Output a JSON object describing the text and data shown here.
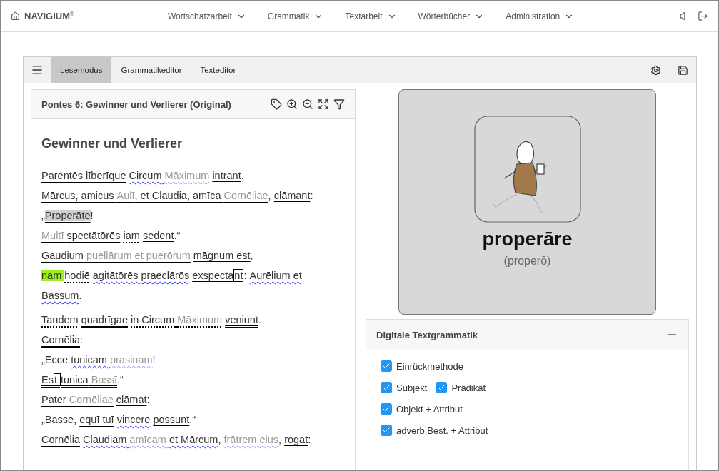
{
  "navbar": {
    "brand": "NAVIGIUM",
    "brand_mark": "®",
    "menus": [
      "Wortschatzarbeit",
      "Grammatik",
      "Textarbeit",
      "Wörterbücher",
      "Administration"
    ]
  },
  "toolbar": {
    "tabs": [
      {
        "label": "Lesemodus",
        "selected": true
      },
      {
        "label": "Grammatikeditor",
        "selected": false
      },
      {
        "label": "Texteditor",
        "selected": false
      }
    ]
  },
  "text_panel": {
    "title": "Pontes 6: Gewinner und Verlierer (Original)",
    "heading": "Gewinner und Verlierer",
    "paragraphs": [
      [
        [
          {
            "text": "Parentēs līberīque",
            "kind": "solid"
          },
          {
            "text": "Circum",
            "kind": "wavy"
          },
          {
            "text": "Māximum",
            "kind": "wavy",
            "muted": true
          },
          {
            "text": "intrant",
            "kind": "double",
            "joined": true
          },
          {
            "text": ".",
            "kind": "none"
          }
        ],
        [
          {
            "text": "Mārcus, amicus",
            "kind": "solid"
          },
          {
            "text": "Aulī",
            "kind": "solid",
            "muted": true,
            "joined": true
          },
          {
            "text": ", et Claudia, amīca",
            "kind": "solid"
          },
          {
            "text": "Cornēliae",
            "kind": "solid",
            "muted": true,
            "joined": true
          },
          {
            "text": ",",
            "kind": "none"
          },
          {
            "text": "clāmant",
            "kind": "double",
            "joined": true
          },
          {
            "text": ":",
            "kind": "none"
          }
        ],
        [
          {
            "text": "„",
            "kind": "none",
            "joined": true
          },
          {
            "text": "Properāte",
            "kind": "solid",
            "selected": true,
            "joined": true
          },
          {
            "text": "!",
            "kind": "none"
          }
        ],
        [
          {
            "text": "Multī",
            "kind": "solid",
            "muted": true
          },
          {
            "text": "spectātōrēs",
            "kind": "solid"
          },
          {
            "text": "iam",
            "kind": "dotted"
          },
          {
            "text": "sedent",
            "kind": "double",
            "joined": true
          },
          {
            "text": ".“",
            "kind": "none"
          }
        ],
        [
          {
            "text": "Gaudium",
            "kind": "solid"
          },
          {
            "text": "puellārum et puerōrum",
            "kind": "solid",
            "muted": true
          },
          {
            "text": "māgnum est",
            "kind": "double",
            "joined": true
          },
          {
            "text": ",",
            "kind": "none"
          }
        ],
        [
          {
            "text": "nam",
            "kind": "none",
            "marked": true
          },
          {
            "text": "hodiē",
            "kind": "dotted"
          },
          {
            "text": "agitātōrēs",
            "kind": "wavy"
          },
          {
            "text": "praeclārōs",
            "kind": "wavy"
          },
          {
            "text": "exspecta",
            "kind": "double",
            "joined": true
          },
          {
            "text": "nt",
            "kind": "double",
            "boxed": true,
            "joined": true
          },
          {
            "text": ":",
            "kind": "none"
          },
          {
            "text": "Aurēlium et",
            "kind": "wavy"
          }
        ],
        [
          {
            "text": "Bassum",
            "kind": "wavy",
            "joined": true
          },
          {
            "text": ".",
            "kind": "none"
          }
        ]
      ],
      [
        [
          {
            "text": "Tandem",
            "kind": "dotted"
          },
          {
            "text": "quadrīgae",
            "kind": "solid"
          },
          {
            "text": "in Circum",
            "kind": "dotted"
          },
          {
            "text": "Māximum",
            "kind": "dotted",
            "muted": true
          },
          {
            "text": "veniunt",
            "kind": "double",
            "joined": true
          },
          {
            "text": ".",
            "kind": "none"
          }
        ],
        [
          {
            "text": "Cornēlia",
            "kind": "solid",
            "joined": true
          },
          {
            "text": ":",
            "kind": "none"
          }
        ],
        [
          {
            "text": "„Ecce",
            "kind": "none"
          },
          {
            "text": "tunicam",
            "kind": "wavy"
          },
          {
            "text": "prasinam",
            "kind": "wavy",
            "muted": true,
            "joined": true
          },
          {
            "text": "!",
            "kind": "none"
          }
        ],
        [
          {
            "text": "Es",
            "kind": "double",
            "joined": true
          },
          {
            "text": "t",
            "kind": "double",
            "boxed": true
          },
          {
            "text": "tunica",
            "kind": "double"
          },
          {
            "text": "Bassī",
            "kind": "double",
            "muted": true,
            "joined": true
          },
          {
            "text": ".“",
            "kind": "none"
          }
        ],
        [
          {
            "text": "Pater",
            "kind": "solid"
          },
          {
            "text": "Cornēliae",
            "kind": "solid",
            "muted": true
          },
          {
            "text": "clāmat",
            "kind": "double",
            "joined": true
          },
          {
            "text": ":",
            "kind": "none"
          }
        ],
        [
          {
            "text": "„Basse,",
            "kind": "none"
          },
          {
            "text": "equī tuī",
            "kind": "solid"
          },
          {
            "text": "vincere",
            "kind": "wavy"
          },
          {
            "text": "possunt",
            "kind": "double",
            "joined": true
          },
          {
            "text": ".“",
            "kind": "none"
          }
        ],
        [
          {
            "text": "Cornēlia",
            "kind": "solid"
          },
          {
            "text": "Claudiam",
            "kind": "wavy"
          },
          {
            "text": "amīcam",
            "kind": "wavy",
            "muted": true
          },
          {
            "text": "et Mārcum",
            "kind": "wavy",
            "joined": true
          },
          {
            "text": ",",
            "kind": "none"
          },
          {
            "text": "frātrem eius",
            "kind": "wavy",
            "muted": true,
            "joined": true
          },
          {
            "text": ",",
            "kind": "none"
          },
          {
            "text": "rogat",
            "kind": "double",
            "joined": true
          },
          {
            "text": ":",
            "kind": "none"
          }
        ]
      ]
    ]
  },
  "word_card": {
    "word": "properāre",
    "base_form": "(properō)"
  },
  "grammar_panel": {
    "title": "Digitale Textgrammatik",
    "rows": [
      [
        {
          "label": "Einrückmethode",
          "checked": true
        }
      ],
      [
        {
          "label": "Subjekt",
          "checked": true
        },
        {
          "label": "Prädikat",
          "checked": true
        }
      ],
      [
        {
          "label": "Objekt + Attribut",
          "checked": true
        }
      ],
      [
        {
          "label": "adverb.Best. + Attribut",
          "checked": true
        }
      ]
    ]
  }
}
